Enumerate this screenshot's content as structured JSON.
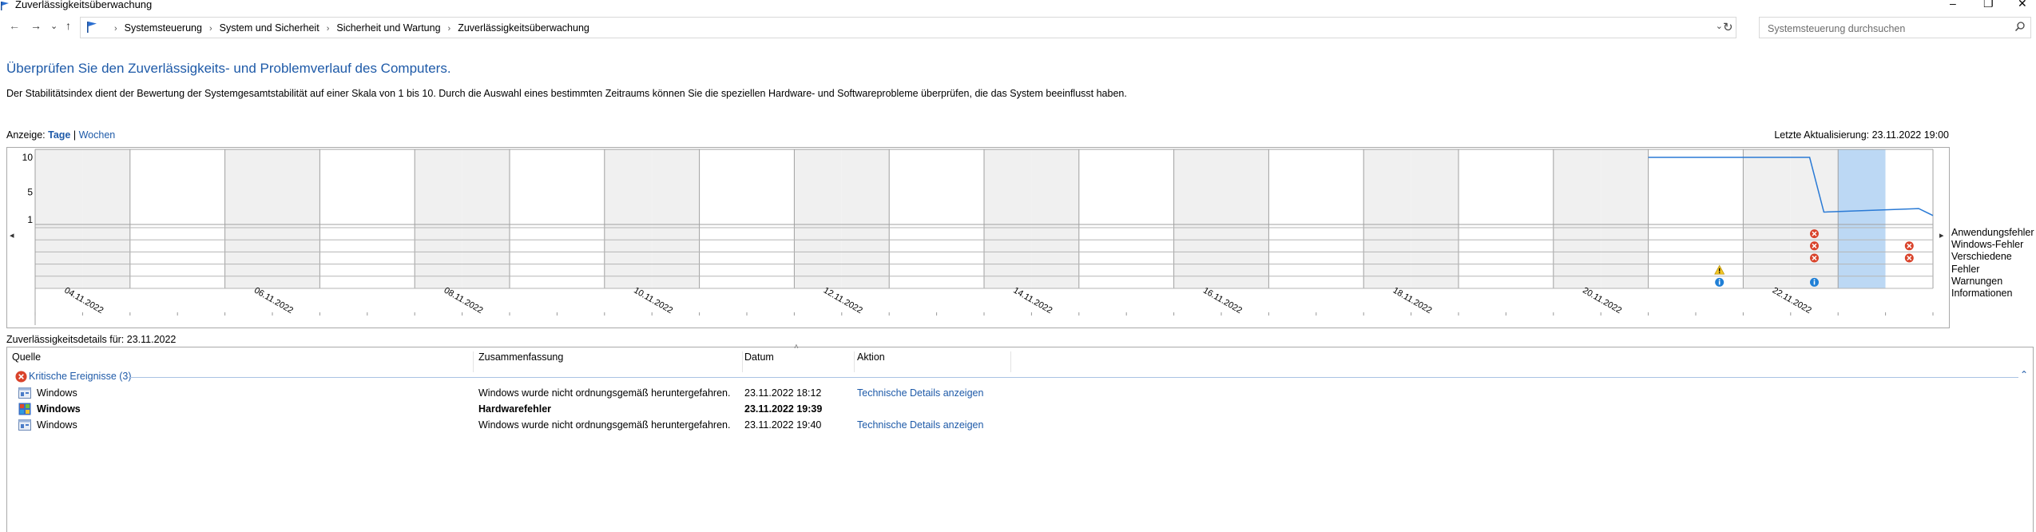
{
  "window": {
    "title": "Zuverlässigkeitsüberwachung"
  },
  "address": {
    "crumbs": [
      "Systemsteuerung",
      "System und Sicherheit",
      "Sicherheit und Wartung",
      "Zuverlässigkeitsüberwachung"
    ],
    "search_placeholder": "Systemsteuerung durchsuchen"
  },
  "page": {
    "heading": "Überprüfen Sie den Zuverlässigkeits- und Problemverlauf des Computers.",
    "description": "Der Stabilitätsindex dient der Bewertung der Systemgesamtstabilität auf einer Skala von 1 bis 10. Durch die Auswahl eines bestimmten Zeitraums können Sie die speziellen Hardware- und Softwareprobleme überprüfen, die das System beeinflusst haben.",
    "view_label": "Anzeige:",
    "view_days": "Tage",
    "view_sep": "|",
    "view_weeks": "Wochen",
    "last_update": "Letzte Aktualisierung: 23.11.2022 19:00"
  },
  "chart_data": {
    "type": "line",
    "y_ticks": [
      "10",
      "5",
      "1"
    ],
    "ylim": [
      1,
      10
    ],
    "days": 40,
    "selected_day": 38,
    "x_labels": [
      {
        "day": 1,
        "text": "04.11.2022"
      },
      {
        "day": 5,
        "text": "06.11.2022"
      },
      {
        "day": 9,
        "text": "08.11.2022"
      },
      {
        "day": 13,
        "text": "10.11.2022"
      },
      {
        "day": 17,
        "text": "12.11.2022"
      },
      {
        "day": 21,
        "text": "14.11.2022"
      },
      {
        "day": 25,
        "text": "16.11.2022"
      },
      {
        "day": 29,
        "text": "18.11.2022"
      },
      {
        "day": 33,
        "text": "20.11.2022"
      },
      {
        "day": 37,
        "text": "22.11.2022"
      }
    ],
    "stability_series": [
      {
        "day": 34.0,
        "value": 10
      },
      {
        "day": 37.4,
        "value": 10
      },
      {
        "day": 37.7,
        "value": 2.1
      },
      {
        "day": 39.7,
        "value": 2.6
      },
      {
        "day": 40.0,
        "value": 1.6
      }
    ],
    "rows": [
      "Anwendungsfehler",
      "Windows-Fehler",
      "Verschiedene Fehler",
      "Warnungen",
      "Informationen"
    ],
    "events": [
      {
        "day": 37,
        "row": 0,
        "kind": "error"
      },
      {
        "day": 37,
        "row": 1,
        "kind": "error"
      },
      {
        "day": 37,
        "row": 2,
        "kind": "error"
      },
      {
        "day": 39,
        "row": 1,
        "kind": "error"
      },
      {
        "day": 39,
        "row": 2,
        "kind": "error"
      },
      {
        "day": 35,
        "row": 3,
        "kind": "warning"
      },
      {
        "day": 35,
        "row": 4,
        "kind": "info"
      },
      {
        "day": 37,
        "row": 4,
        "kind": "info"
      }
    ],
    "colors": {
      "line": "#2a7ad5",
      "weekend": "#f0f0f0",
      "selected": "#bcd8f4",
      "error": "#d9432b",
      "warning": "#f3c623",
      "info": "#1f7fd6"
    }
  },
  "details": {
    "label": "Zuverlässigkeitsdetails für: 23.11.2022",
    "columns": [
      "Quelle",
      "Zusammenfassung",
      "Datum",
      "Aktion"
    ],
    "group_title": "Kritische Ereignisse (3)",
    "rows": [
      {
        "source": "Windows",
        "summary": "Windows wurde nicht ordnungsgemäß heruntergefahren.",
        "date": "23.11.2022 18:12",
        "action": "Technische Details anzeigen",
        "bold": false
      },
      {
        "source": "Windows",
        "summary": "Hardwarefehler",
        "date": "23.11.2022 19:39",
        "action": "",
        "bold": true
      },
      {
        "source": "Windows",
        "summary": "Windows wurde nicht ordnungsgemäß heruntergefahren.",
        "date": "23.11.2022 19:40",
        "action": "Technische Details anzeigen",
        "bold": false
      }
    ]
  }
}
